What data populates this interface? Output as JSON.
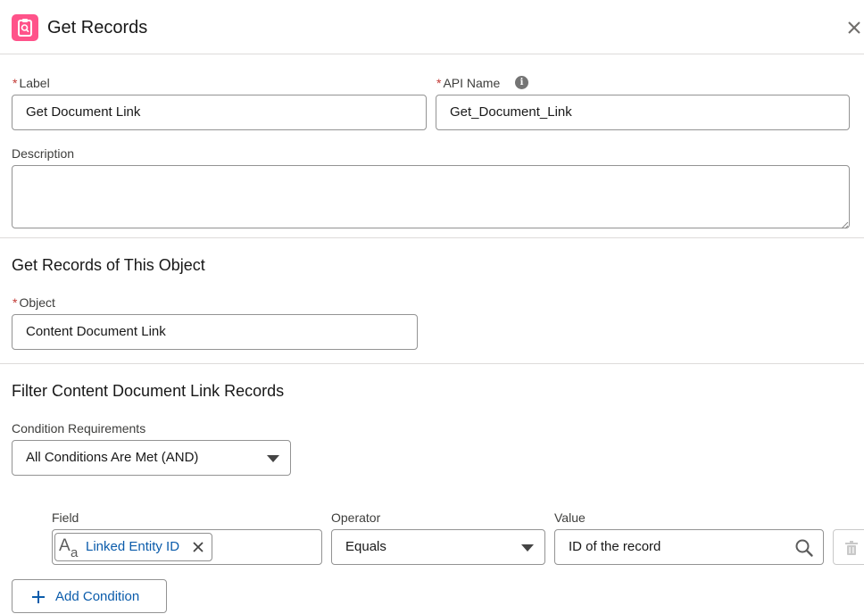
{
  "header": {
    "title": "Get Records"
  },
  "fields": {
    "label": {
      "required": "*",
      "label": "Label",
      "value": "Get Document Link"
    },
    "api_name": {
      "required": "*",
      "label": "API Name",
      "info_glyph": "i",
      "value": "Get_Document_Link"
    },
    "description": {
      "label": "Description",
      "value": ""
    }
  },
  "object_section": {
    "title": "Get Records of This Object",
    "object": {
      "required": "*",
      "label": "Object",
      "value": "Content Document Link"
    }
  },
  "filter_section": {
    "title": "Filter Content Document Link Records",
    "condition_requirements": {
      "label": "Condition Requirements",
      "value": "All Conditions Are Met (AND)"
    },
    "condition": {
      "field_label": "Field",
      "field_value": "Linked Entity ID",
      "operator_label": "Operator",
      "operator_value": "Equals",
      "value_label": "Value",
      "value_value": "ID of the record"
    },
    "add_condition_label": "Add Condition"
  },
  "icons": {
    "header": "get-records-icon",
    "close": "close-icon",
    "info": "info-icon",
    "text_type": "text-type-icon",
    "remove": "close-icon",
    "dropdown": "chevron-down-icon",
    "search": "search-icon",
    "add": "plus-icon",
    "delete": "trash-icon"
  },
  "colors": {
    "accent": "#ff538a",
    "link": "#0b5cab",
    "required": "#c23934",
    "border": "#939393",
    "divider": "#dddbda"
  }
}
